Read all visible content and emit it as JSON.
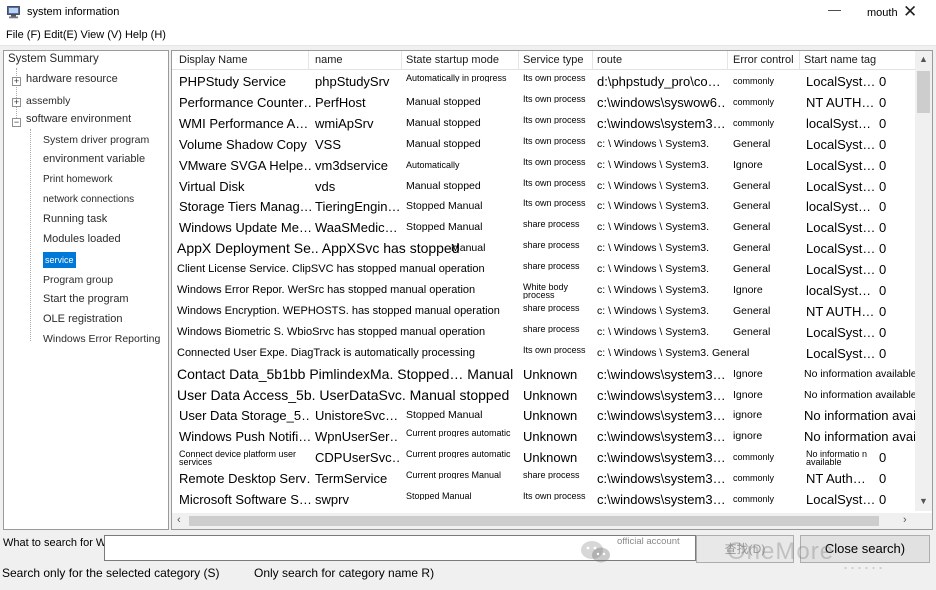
{
  "window": {
    "title": "system information",
    "right_label": "mouth",
    "minimize_glyph": "—",
    "close_glyph": "✕"
  },
  "menu": {
    "text": "File (F) Edit(E) View (V) Help (H)"
  },
  "tree": {
    "root": "System Summary",
    "groups": [
      {
        "label": "hardware resource",
        "expander": "+"
      },
      {
        "label": "assembly",
        "expander": "+"
      },
      {
        "label": "software environment",
        "expander": "−"
      }
    ],
    "children": [
      "System driver program",
      "environment variable",
      "Print homework",
      "network connections",
      "Running task",
      "Modules loaded",
      "service",
      "Program group",
      "Start the program",
      "OLE registration",
      "Windows Error Reporting"
    ],
    "selected_child": "service"
  },
  "table": {
    "headers": [
      "Display Name",
      "name",
      "State startup mode",
      "Service type",
      "route",
      "Error control",
      "Start name tag"
    ],
    "rows": [
      {
        "display": "PHPStudy Service",
        "name": "phpStudySrv",
        "state": "Automatically in progress",
        "state_style": "stack",
        "type": "Its own process",
        "type_style": "stack",
        "route": "d:\\phpstudy_pro\\co…",
        "route_style": "normal",
        "error": "commonly",
        "error_style": "xs",
        "start": "LocalSyst…",
        "tag": "0"
      },
      {
        "display": "Performance Counter…",
        "name": "PerfHost",
        "state": "Manual stopped",
        "state_style": "sm",
        "type": "Its own process",
        "type_style": "stack",
        "route": "c:\\windows\\syswow6…",
        "route_style": "normal",
        "error": "commonly",
        "error_style": "xs",
        "start": "NT AUTH…",
        "tag": "0"
      },
      {
        "display": "WMI Performance A…",
        "name": "wmiApSrv",
        "state": "Manual stopped",
        "state_style": "sm",
        "type": "Its own process",
        "type_style": "stack",
        "route": "c:\\windows\\system3…",
        "route_style": "normal",
        "error": "commonly",
        "error_style": "xs",
        "start": "localSyst…",
        "tag": "0"
      },
      {
        "display": "Volume Shadow Copy",
        "name": "VSS",
        "state": "Manual stopped",
        "state_style": "sm",
        "type": "Its own process",
        "type_style": "stack",
        "route": "c: \\ Windows \\ System3.",
        "route_style": "sm",
        "error": "General",
        "error_style": "sm",
        "start": "LocalSyst…",
        "tag": "0"
      },
      {
        "display": "VMware SVGA Helpe…",
        "name": "vm3dservice",
        "state": "Automatically",
        "state_style": "xs",
        "type": "Its own process",
        "type_style": "stack",
        "route": "c: \\ Windows \\ System3.",
        "route_style": "sm",
        "error": "Ignore",
        "error_style": "sm",
        "start": "LocalSyst…",
        "tag": "0"
      },
      {
        "display": "Virtual Disk",
        "name": "vds",
        "state": "Manual stopped",
        "state_style": "sm",
        "type": "Its own process",
        "type_style": "stack",
        "route": "c: \\ Windows \\ System3.",
        "route_style": "sm",
        "error": "General",
        "error_style": "sm",
        "start": "LocalSyst…",
        "tag": "0"
      },
      {
        "display": "Storage Tiers Manag…",
        "name": "TieringEngin…",
        "state": "Stopped  Manual",
        "state_style": "sm",
        "type": "Its own process",
        "type_style": "stack",
        "route": "c: \\ Windows \\ System3.",
        "route_style": "sm",
        "error": "General",
        "error_style": "sm",
        "start": "localSyst…",
        "tag": "0"
      },
      {
        "display": "Windows Update Me…",
        "name": "WaaSMedic…",
        "state": "Stopped  Manual",
        "state_style": "sm",
        "type": "share process",
        "type_style": "stack",
        "route": "c: \\ Windows \\ System3.",
        "route_style": "sm",
        "error": "General",
        "error_style": "sm",
        "start": "LocalSyst…",
        "tag": "0"
      },
      {
        "merged": "AppX Deployment Se.. AppXSvc has stopped",
        "merged_style": "merged-lg",
        "state": "Manual",
        "state_style": "sm",
        "type": "share process",
        "type_style": "stack",
        "route": "c: \\ Windows \\ System3.",
        "route_style": "sm",
        "error": "General",
        "error_style": "sm",
        "start": "LocalSyst…",
        "tag": "0"
      },
      {
        "merged": "Client License Service. ClipSVC has stopped manual operation",
        "merged_style": "merged",
        "type": "share process",
        "type_style": "stack",
        "route": "c: \\ Windows \\ System3.",
        "route_style": "sm",
        "error": "General",
        "error_style": "sm",
        "start": "LocalSyst…",
        "tag": "0"
      },
      {
        "merged": "Windows Error Repor. WerSrc has stopped manual operation",
        "merged_style": "merged",
        "type": "White body process",
        "type_style": "stack",
        "route": "c: \\ Windows \\ System3.",
        "route_style": "sm",
        "error": "Ignore",
        "error_style": "sm",
        "start": "localSyst…",
        "tag": "0"
      },
      {
        "merged": "Windows Encryption. WEPHOSTS. has stopped manual operation",
        "merged_style": "merged",
        "type": "share process",
        "type_style": "stack",
        "route": "c: \\ Windows \\ System3.",
        "route_style": "sm",
        "error": "General",
        "error_style": "sm",
        "start": "NT AUTH…",
        "tag": "0"
      },
      {
        "merged": "Windows Biometric S. WbioSrvc has stopped manual operation",
        "merged_style": "merged",
        "type": "share process",
        "type_style": "stack",
        "route": "c: \\ Windows \\ System3.",
        "route_style": "sm",
        "error": "General",
        "error_style": "sm",
        "start": "LocalSyst…",
        "tag": "0"
      },
      {
        "merged": "Connected User Expe. DiagTrack is automatically processing",
        "merged_style": "merged",
        "type": "Its own process",
        "type_style": "stack",
        "route": "c: \\ Windows \\ System3. General",
        "route_style": "sm",
        "start": "LocalSyst…",
        "tag": "0"
      },
      {
        "merged": "Contact Data_5b1bb PimlindexMa. Stopped… Manual",
        "merged_style": "merged-lg",
        "type": "Unknown",
        "type_style": "normal",
        "route": "c:\\windows\\system3…",
        "route_style": "normal",
        "error": "Ignore",
        "error_style": "sm",
        "start_wide": "No information available",
        "start_style": "sm"
      },
      {
        "merged": "User Data Access_5b. UserDataSvc. Manual stopped",
        "merged_style": "merged-lg",
        "type": "Unknown",
        "type_style": "normal",
        "route": "c:\\windows\\system3…",
        "route_style": "normal",
        "error": "Ignore",
        "error_style": "sm",
        "start_wide": "No information available",
        "start_style": "sm"
      },
      {
        "display": "User Data Storage_5…",
        "name": "UnistoreSvc…",
        "state": "Stopped  Manual",
        "state_style": "sm",
        "type": "Unknown",
        "type_style": "normal",
        "route": "c:\\windows\\system3…",
        "route_style": "normal",
        "error": "ignore",
        "error_style": "sm",
        "start_wide": "No information available",
        "start_style": "normal"
      },
      {
        "display": "Windows Push Notifi…",
        "name": "WpnUserSer…",
        "state": "Current progres  automatic",
        "state_style": "stack",
        "type": "Unknown",
        "type_style": "normal",
        "route": "c:\\windows\\system3…",
        "route_style": "normal",
        "error": "ignore",
        "error_style": "sm",
        "start_wide": "No information available",
        "start_style": "normal"
      },
      {
        "display": "Connect device platform user services",
        "display_style": "stack",
        "name": "CDPUserSvc…",
        "state": "Current progres  automatic",
        "state_style": "stack",
        "type": "Unknown",
        "type_style": "normal",
        "route": "c:\\windows\\system3…",
        "route_style": "normal",
        "error": "commonly",
        "error_style": "xs",
        "start": "No informatio n available",
        "start_style": "stack",
        "tag": "0"
      },
      {
        "display": "Remote Desktop Serv…",
        "name": "TermService",
        "state": "Current progres  Manual",
        "state_style": "stack",
        "type": "share process",
        "type_style": "stack",
        "route": "c:\\windows\\system3…",
        "route_style": "normal",
        "error": "commonly",
        "error_style": "xs",
        "start": "NT Auth…",
        "tag": "0"
      },
      {
        "display": "Microsoft Software S…",
        "name": "swprv",
        "state": "Stopped  Manual",
        "state_style": "stack",
        "type": "Its own process",
        "type_style": "stack",
        "route": "c:\\windows\\system3…",
        "route_style": "normal",
        "error": "commonly",
        "error_style": "xs",
        "start": "LocalSyst…",
        "tag": "0"
      }
    ]
  },
  "search": {
    "label": "What to search for W:",
    "value": "",
    "find_button": "查找(D)",
    "close_button": "Close search)",
    "option_selected_category": "Search only for the selected category (S)",
    "option_category_name": "Only search for category name R)"
  },
  "watermark": {
    "text": "OneMore",
    "dots": "......",
    "account_label": "official account"
  },
  "colors": {
    "selection": "#0078d7",
    "grid_bg": "#ffffff",
    "window_bg": "#f0f0f0"
  }
}
